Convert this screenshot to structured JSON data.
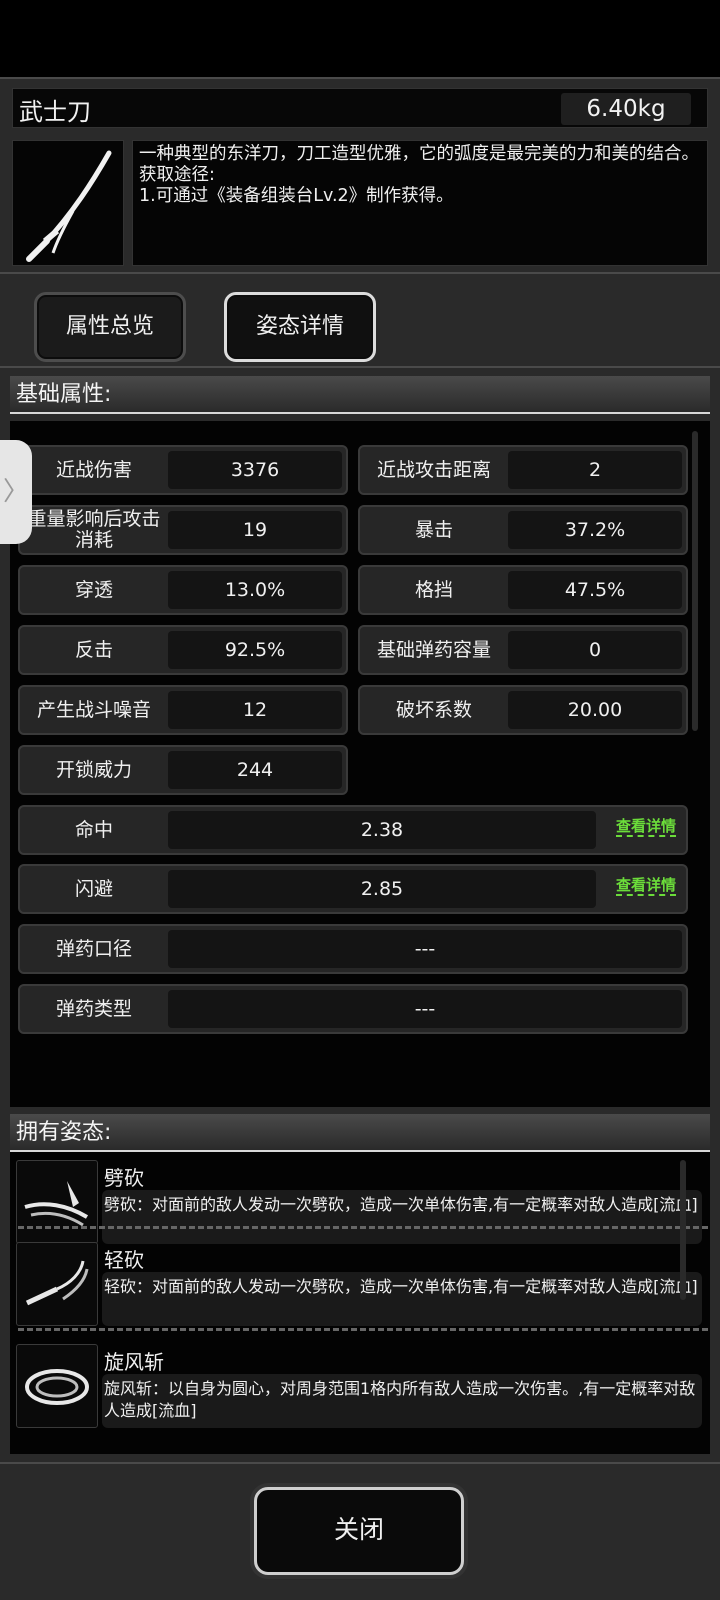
{
  "item": {
    "name": "武士刀",
    "weight": "6.40kg",
    "description_lines": [
      "一种典型的东洋刀，刀工造型优雅，它的弧度是最完美的力和美的结合。",
      "获取途径:",
      "1.可通过《装备组装台Lv.2》制作获得。"
    ],
    "icon": "katana-icon"
  },
  "tabs": {
    "overview": "属性总览",
    "stance_details": "姿态详情",
    "active": "stance_details"
  },
  "basic_section": {
    "title": "基础属性:",
    "attributes": [
      {
        "label": "近战伤害",
        "value": "3376"
      },
      {
        "label": "近战攻击距离",
        "value": "2"
      },
      {
        "label": "重量影响后攻击消耗",
        "value": "19"
      },
      {
        "label": "暴击",
        "value": "37.2%"
      },
      {
        "label": "穿透",
        "value": "13.0%"
      },
      {
        "label": "格挡",
        "value": "47.5%"
      },
      {
        "label": "反击",
        "value": "92.5%"
      },
      {
        "label": "基础弹药容量",
        "value": "0"
      },
      {
        "label": "产生战斗噪音",
        "value": "12"
      },
      {
        "label": "破坏系数",
        "value": "20.00"
      },
      {
        "label": "开锁威力",
        "value": "244"
      }
    ],
    "wide_attributes": [
      {
        "label": "命中",
        "value": "2.38",
        "link": "查看详情"
      },
      {
        "label": "闪避",
        "value": "2.85",
        "link": "查看详情"
      },
      {
        "label": "弹药口径",
        "value": "---"
      },
      {
        "label": "弹药类型",
        "value": "---"
      }
    ]
  },
  "stance_section": {
    "title": "拥有姿态:",
    "stances": [
      {
        "name": "劈砍",
        "description": "劈砍：对面前的敌人发动一次劈砍，造成一次单体伤害,有一定概率对敌人造成[流血]",
        "icon": "slash-icon"
      },
      {
        "name": "轻砍",
        "description": "轻砍：对面前的敌人发动一次劈砍，造成一次单体伤害,有一定概率对敌人造成[流血]",
        "icon": "light-slash-icon"
      },
      {
        "name": "旋风斩",
        "description": "旋风斩：以自身为圆心，对周身范围1格内所有敌人造成一次伤害。,有一定概率对敌人造成[流血]",
        "icon": "whirlwind-icon"
      }
    ]
  },
  "side_handle": "〉",
  "close_button": "关闭"
}
